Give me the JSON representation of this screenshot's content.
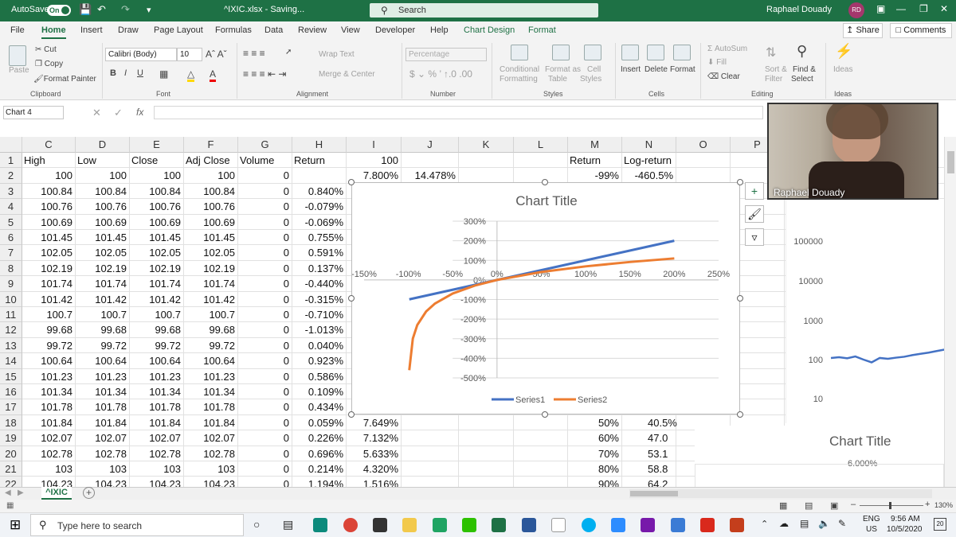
{
  "titlebar": {
    "autosave_label": "AutoSave",
    "autosave_state": "On",
    "filename": "^IXIC.xlsx - Saving...",
    "search_placeholder": "Search",
    "user_name": "Raphael Douady",
    "user_initials": "RD"
  },
  "menu": {
    "tabs": [
      "File",
      "Home",
      "Insert",
      "Draw",
      "Page Layout",
      "Formulas",
      "Data",
      "Review",
      "View",
      "Developer",
      "Help",
      "Chart Design",
      "Format"
    ],
    "share": "Share",
    "comments": "Comments"
  },
  "ribbon": {
    "clipboard": {
      "paste": "Paste",
      "cut": "Cut",
      "copy": "Copy",
      "format_painter": "Format Painter",
      "group": "Clipboard"
    },
    "font": {
      "font_name": "Calibri (Body)",
      "font_size": "10",
      "group": "Font"
    },
    "alignment": {
      "wrap_text": "Wrap Text",
      "merge_center": "Merge & Center",
      "group": "Alignment"
    },
    "number": {
      "format": "Percentage",
      "group": "Number"
    },
    "styles": {
      "conditional": "Conditional",
      "formatting": "Formatting",
      "format_as": "Format as",
      "table": "Table",
      "cell": "Cell",
      "styles_lbl": "Styles",
      "group": "Styles"
    },
    "cells": {
      "insert": "Insert",
      "delete": "Delete",
      "format": "Format",
      "group": "Cells"
    },
    "editing": {
      "autosum": "AutoSum",
      "fill": "Fill",
      "clear": "Clear",
      "sort": "Sort &",
      "filter": "Filter",
      "find": "Find &",
      "select": "Select",
      "group": "Editing"
    },
    "ideas": {
      "label": "Ideas",
      "group": "Ideas"
    }
  },
  "formula_bar": {
    "name_box": "Chart 4",
    "fx": "fx"
  },
  "columns": [
    "C",
    "D",
    "E",
    "F",
    "G",
    "H",
    "I",
    "J",
    "K",
    "L",
    "M",
    "N",
    "O",
    "P"
  ],
  "rows": [
    "1",
    "2",
    "3",
    "4",
    "5",
    "6",
    "7",
    "8",
    "9",
    "10",
    "11",
    "12",
    "13",
    "14",
    "15",
    "16",
    "17",
    "18",
    "19",
    "20",
    "21",
    "22"
  ],
  "headers": {
    "C": "High",
    "D": "Low",
    "E": "Close",
    "F": "Adj Close",
    "G": "Volume",
    "H": "Return",
    "I": "100",
    "M": "Return",
    "N": "Log-return"
  },
  "row2": {
    "C": "100",
    "D": "100",
    "E": "100",
    "F": "100",
    "G": "0",
    "I": "7.800%",
    "J": "14.478%",
    "M": "-99%",
    "N": "-460.5%"
  },
  "table": [
    [
      "100.84",
      "100.84",
      "100.84",
      "100.84",
      "0",
      "0.840%"
    ],
    [
      "100.76",
      "100.76",
      "100.76",
      "100.76",
      "0",
      "-0.079%"
    ],
    [
      "100.69",
      "100.69",
      "100.69",
      "100.69",
      "0",
      "-0.069%"
    ],
    [
      "101.45",
      "101.45",
      "101.45",
      "101.45",
      "0",
      "0.755%"
    ],
    [
      "102.05",
      "102.05",
      "102.05",
      "102.05",
      "0",
      "0.591%"
    ],
    [
      "102.19",
      "102.19",
      "102.19",
      "102.19",
      "0",
      "0.137%"
    ],
    [
      "101.74",
      "101.74",
      "101.74",
      "101.74",
      "0",
      "-0.440%"
    ],
    [
      "101.42",
      "101.42",
      "101.42",
      "101.42",
      "0",
      "-0.315%"
    ],
    [
      "100.7",
      "100.7",
      "100.7",
      "100.7",
      "0",
      "-0.710%"
    ],
    [
      "99.68",
      "99.68",
      "99.68",
      "99.68",
      "0",
      "-1.013%"
    ],
    [
      "99.72",
      "99.72",
      "99.72",
      "99.72",
      "0",
      "0.040%"
    ],
    [
      "100.64",
      "100.64",
      "100.64",
      "100.64",
      "0",
      "0.923%"
    ],
    [
      "101.23",
      "101.23",
      "101.23",
      "101.23",
      "0",
      "0.586%"
    ],
    [
      "101.34",
      "101.34",
      "101.34",
      "101.34",
      "0",
      "0.109%"
    ],
    [
      "101.78",
      "101.78",
      "101.78",
      "101.78",
      "0",
      "0.434%"
    ],
    [
      "101.84",
      "101.84",
      "101.84",
      "101.84",
      "0",
      "0.059%"
    ],
    [
      "102.07",
      "102.07",
      "102.07",
      "102.07",
      "0",
      "0.226%"
    ],
    [
      "102.78",
      "102.78",
      "102.78",
      "102.78",
      "0",
      "0.696%"
    ],
    [
      "103",
      "103",
      "103",
      "103",
      "0",
      "0.214%"
    ],
    [
      "104.23",
      "104.23",
      "104.23",
      "104.23",
      "0",
      "1.194%"
    ]
  ],
  "col_i_lower": {
    "r18": "7.649%",
    "r19": "7.132%",
    "r20": "5.633%",
    "r21": "4.320%",
    "r22": "1.516%"
  },
  "col_mn_lower": [
    [
      "50%",
      "40.5%"
    ],
    [
      "60%",
      "47.0"
    ],
    [
      "70%",
      "53.1"
    ],
    [
      "80%",
      "58.8"
    ],
    [
      "90%",
      "64.2"
    ]
  ],
  "chart_data": [
    {
      "type": "line",
      "title": "Chart Title",
      "x_ticks": [
        "-150%",
        "-100%",
        "-50%",
        "0%",
        "50%",
        "100%",
        "150%",
        "200%",
        "250%"
      ],
      "y_ticks": [
        "300%",
        "200%",
        "100%",
        "0%",
        "-100%",
        "-200%",
        "-300%",
        "-400%",
        "-500%"
      ],
      "xlim": [
        -150,
        250
      ],
      "ylim": [
        -500,
        300
      ],
      "series": [
        {
          "name": "Series1",
          "color": "#4472c4",
          "x": [
            -99,
            0,
            200
          ],
          "y": [
            -99,
            0,
            200
          ]
        },
        {
          "name": "Series2",
          "color": "#ed7d31",
          "x": [
            -99,
            -95,
            -90,
            -80,
            -70,
            -50,
            -25,
            0,
            50,
            100,
            150,
            200
          ],
          "y": [
            -460.5,
            -299.6,
            -230.3,
            -160.9,
            -120.4,
            -69.3,
            -28.8,
            0,
            40.5,
            69.3,
            91.6,
            109.9
          ]
        }
      ]
    },
    {
      "type": "line",
      "y_scale": "log",
      "y_ticks": [
        "100000",
        "10000",
        "1000",
        "100",
        "10"
      ],
      "series": [
        {
          "color": "#4472c4",
          "y": [
            110,
            115,
            108,
            120,
            100,
            85,
            110,
            105,
            112,
            118,
            130,
            140,
            150,
            165,
            180
          ]
        }
      ]
    },
    {
      "type": "line",
      "title": "Chart Title",
      "y_ticks": [
        "6.000%"
      ]
    }
  ],
  "sheet": {
    "tab": "^IXIC"
  },
  "status": {
    "zoom": "130%"
  },
  "video": {
    "name": "Raphael Douady"
  },
  "taskbar": {
    "search": "Type here to search",
    "lang": "ENG",
    "region": "US",
    "time": "9:56 AM",
    "date": "10/5/2020",
    "notif": "20"
  }
}
